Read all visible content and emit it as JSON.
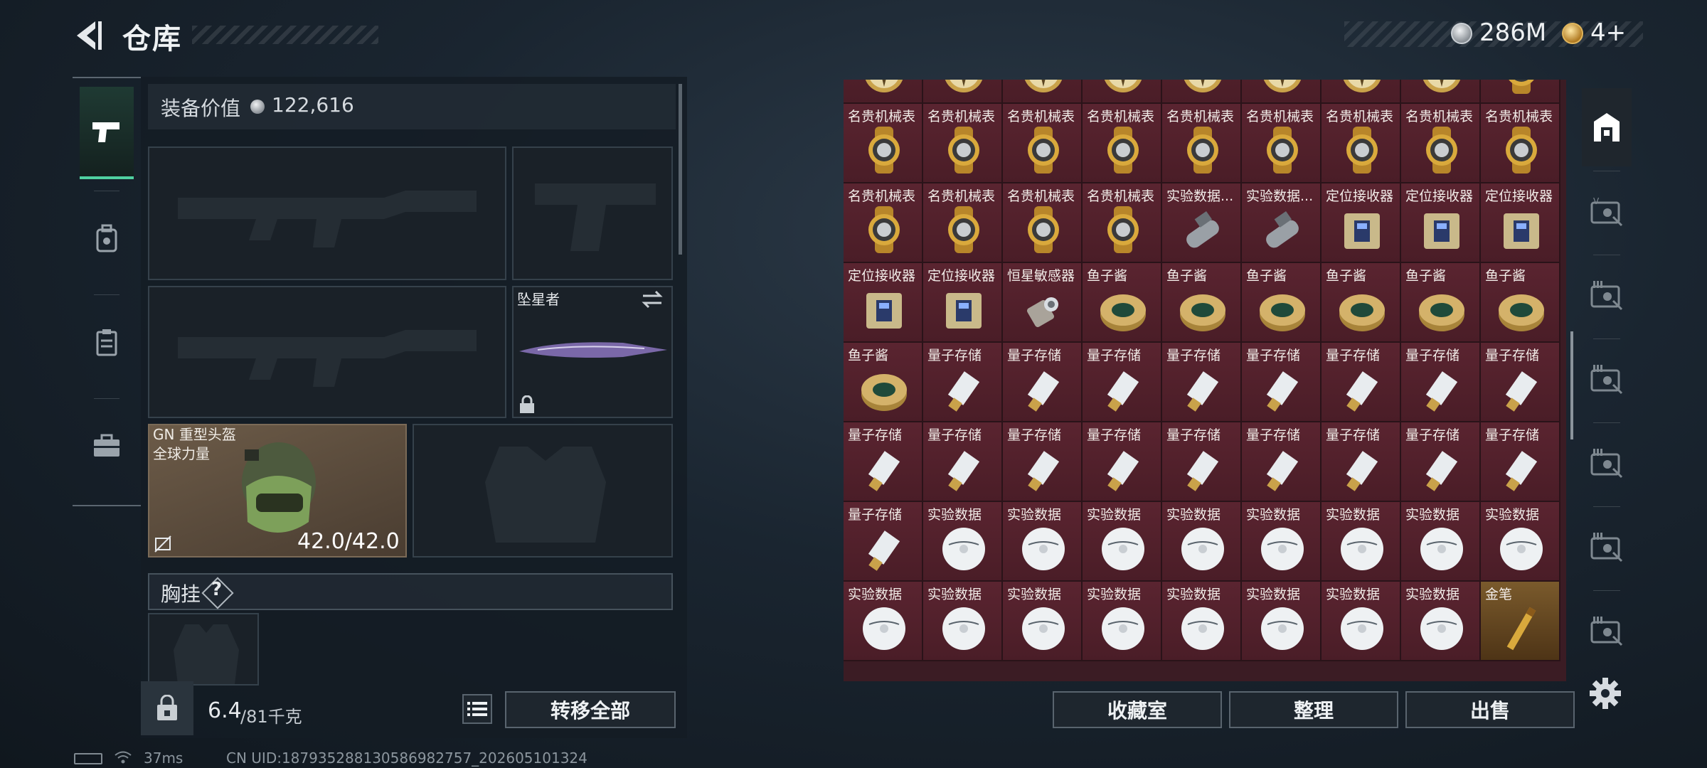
{
  "header": {
    "title": "仓库",
    "silver_value": "286M",
    "gold_value": "4+"
  },
  "nav": {
    "items": [
      {
        "icon": "pistol-icon",
        "active": true
      },
      {
        "icon": "backpack-icon",
        "active": false
      },
      {
        "icon": "clipboard-icon",
        "active": false
      },
      {
        "icon": "toolbox-icon",
        "active": false
      }
    ]
  },
  "equipment": {
    "label": "装备价值",
    "value": "122,616",
    "melee_name": "坠星者",
    "helmet_name": "GN 重型头盔",
    "helmet_sub": "全球力量",
    "helmet_durability": "42.0/42.0",
    "chest_label": "胸挂",
    "chest_help": "?"
  },
  "weight": {
    "current": "6.4",
    "max": "/81千克"
  },
  "buttons": {
    "transfer_all": "转移全部",
    "collection": "收藏室",
    "organize": "整理",
    "sell": "出售"
  },
  "storage": {
    "rows": [
      [
        "",
        "",
        "",
        "",
        "",
        "",
        "",
        "",
        ""
      ],
      [
        "名贵机械表",
        "名贵机械表",
        "名贵机械表",
        "名贵机械表",
        "名贵机械表",
        "名贵机械表",
        "名贵机械表",
        "名贵机械表",
        "名贵机械表"
      ],
      [
        "名贵机械表",
        "名贵机械表",
        "名贵机械表",
        "名贵机械表",
        "实验数据...",
        "实验数据...",
        "定位接收器",
        "定位接收器",
        "定位接收器"
      ],
      [
        "定位接收器",
        "定位接收器",
        "恒星敏感器",
        "鱼子酱",
        "鱼子酱",
        "鱼子酱",
        "鱼子酱",
        "鱼子酱",
        "鱼子酱"
      ],
      [
        "鱼子酱",
        "量子存储",
        "量子存储",
        "量子存储",
        "量子存储",
        "量子存储",
        "量子存储",
        "量子存储",
        "量子存储"
      ],
      [
        "量子存储",
        "量子存储",
        "量子存储",
        "量子存储",
        "量子存储",
        "量子存储",
        "量子存储",
        "量子存储",
        "量子存储"
      ],
      [
        "量子存储",
        "实验数据",
        "实验数据",
        "实验数据",
        "实验数据",
        "实验数据",
        "实验数据",
        "实验数据",
        "实验数据"
      ],
      [
        "实验数据",
        "实验数据",
        "实验数据",
        "实验数据",
        "实验数据",
        "实验数据",
        "实验数据",
        "实验数据",
        "金笔"
      ]
    ],
    "art": [
      [
        "compass",
        "compass",
        "compass",
        "compass",
        "compass",
        "compass",
        "compass",
        "compass",
        "watch"
      ],
      [
        "watch",
        "watch",
        "watch",
        "watch",
        "watch",
        "watch",
        "watch",
        "watch",
        "watch"
      ],
      [
        "watch",
        "watch",
        "watch",
        "watch",
        "cylinder",
        "cylinder",
        "receiver",
        "receiver",
        "receiver"
      ],
      [
        "receiver",
        "receiver",
        "sensor",
        "caviar",
        "caviar",
        "caviar",
        "caviar",
        "caviar",
        "caviar"
      ],
      [
        "caviar",
        "usb",
        "usb",
        "usb",
        "usb",
        "usb",
        "usb",
        "usb",
        "usb"
      ],
      [
        "usb",
        "usb",
        "usb",
        "usb",
        "usb",
        "usb",
        "usb",
        "usb",
        "usb"
      ],
      [
        "usb",
        "disc",
        "disc",
        "disc",
        "disc",
        "disc",
        "disc",
        "disc",
        "disc"
      ],
      [
        "disc",
        "disc",
        "disc",
        "disc",
        "disc",
        "disc",
        "disc",
        "disc",
        "pen"
      ]
    ]
  },
  "right_tabs": [
    "safe-icon",
    "vip-card-icon",
    "level-3-card-icon",
    "level-3-card-icon",
    "level-3-card-icon",
    "level-3-card-icon",
    "level-3-card-icon"
  ],
  "status": {
    "ping": "37ms",
    "uid": "CN UID:18793528813058698​2757_202605101324"
  },
  "colors": {
    "accent_green": "#4fd0a0",
    "storage_bg": "#4a1d27",
    "helmet_bg": "#6c5b48"
  }
}
